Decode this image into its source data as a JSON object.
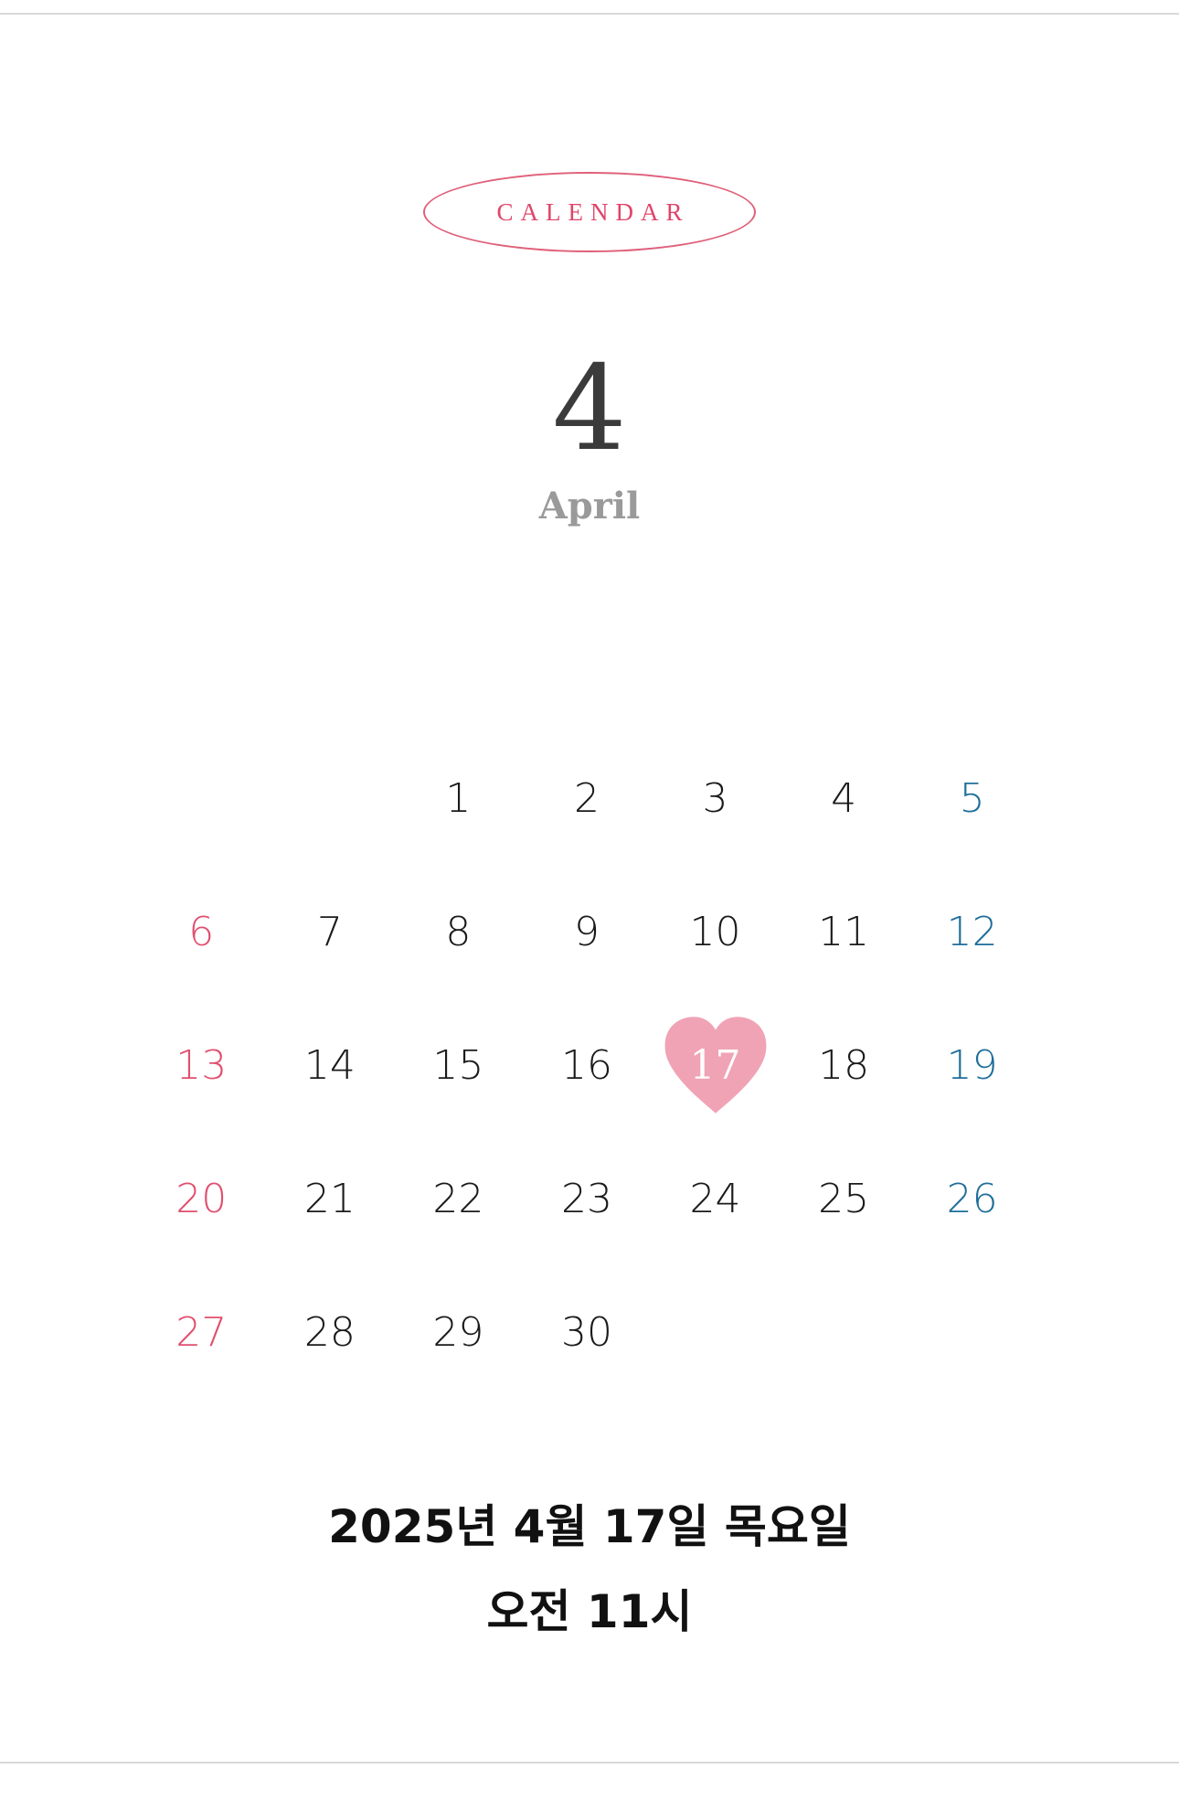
{
  "badge": {
    "label": "CALENDAR"
  },
  "month": {
    "number": "4",
    "name": "April"
  },
  "calendar": {
    "weeks": [
      [
        "",
        "",
        "1",
        "2",
        "3",
        "4",
        "5"
      ],
      [
        "6",
        "7",
        "8",
        "9",
        "10",
        "11",
        "12"
      ],
      [
        "13",
        "14",
        "15",
        "16",
        "17",
        "18",
        "19"
      ],
      [
        "20",
        "21",
        "22",
        "23",
        "24",
        "25",
        "26"
      ],
      [
        "27",
        "28",
        "29",
        "30",
        "",
        "",
        ""
      ]
    ],
    "highlight_day": "17"
  },
  "footer": {
    "date": "2025년 4월 17일 목요일",
    "time": "오전 11시"
  },
  "colors": {
    "accent_pink": "#e0456a",
    "heart": "#f0a3b5",
    "saturday_blue": "#1f6e9a",
    "sunday_pink": "#e0506e"
  }
}
